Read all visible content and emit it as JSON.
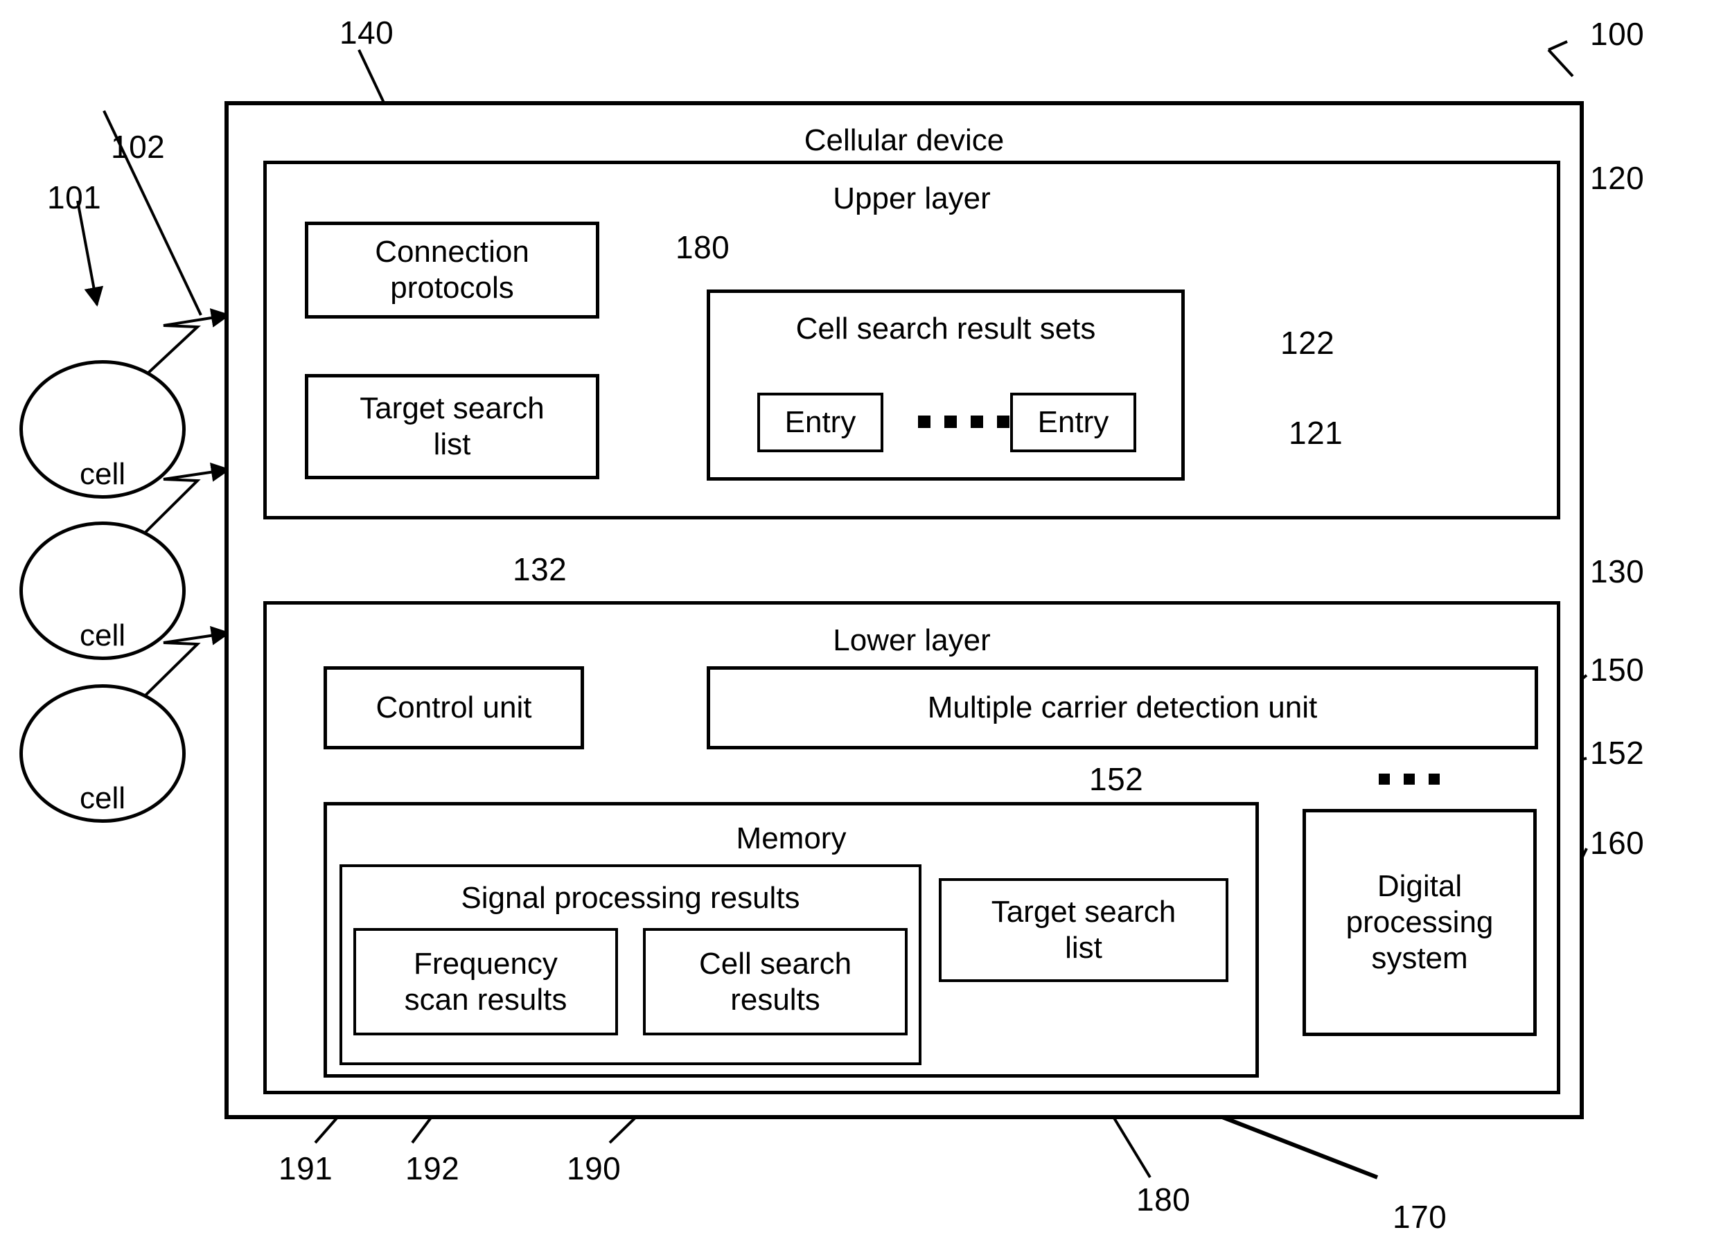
{
  "figure": {
    "domain": "patent-block-diagram",
    "device_title": "Cellular device",
    "upper_layer_title": "Upper layer",
    "lower_layer_title": "Lower layer",
    "cells": [
      {
        "label": "cell",
        "icon": "antenna-icon"
      },
      {
        "label": "cell",
        "icon": "antenna-icon"
      },
      {
        "label": "cell",
        "icon": "antenna-icon"
      }
    ],
    "upper_layer_blocks": [
      {
        "label": "Connection\nprotocols"
      },
      {
        "label": "Target search\nlist"
      }
    ],
    "cell_search_result_sets": {
      "title": "Cell search result sets",
      "entries": [
        {
          "label": "Entry"
        },
        {
          "label": "Entry"
        }
      ],
      "ellipsis_dots": 4
    },
    "lower_layer_blocks": [
      {
        "label": "Control unit"
      },
      {
        "label": "Multiple carrier detection unit"
      }
    ],
    "memory": {
      "title": "Memory",
      "signal_processing_results": {
        "title": "Signal processing results",
        "items": [
          {
            "label": "Frequency\nscan results"
          },
          {
            "label": "Cell search\nresults"
          }
        ]
      },
      "target_search_list": {
        "label": "Target search\nlist"
      }
    },
    "digital_processing_system": {
      "label": "Digital\nprocessing\nsystem"
    },
    "interface_dots": 3,
    "reference_numerals": {
      "n101": "101",
      "n102": "102",
      "n140": "140",
      "n100": "100",
      "n120": "120",
      "n180_upper": "180",
      "n122": "122",
      "n121": "121",
      "n132": "132",
      "n130": "130",
      "n150": "150",
      "n152_left": "152",
      "n152_right": "152",
      "n160": "160",
      "n191": "191",
      "n192": "192",
      "n190": "190",
      "n180_lower": "180",
      "n170": "170"
    },
    "colors": {
      "stroke": "#000000",
      "background": "#ffffff"
    }
  }
}
